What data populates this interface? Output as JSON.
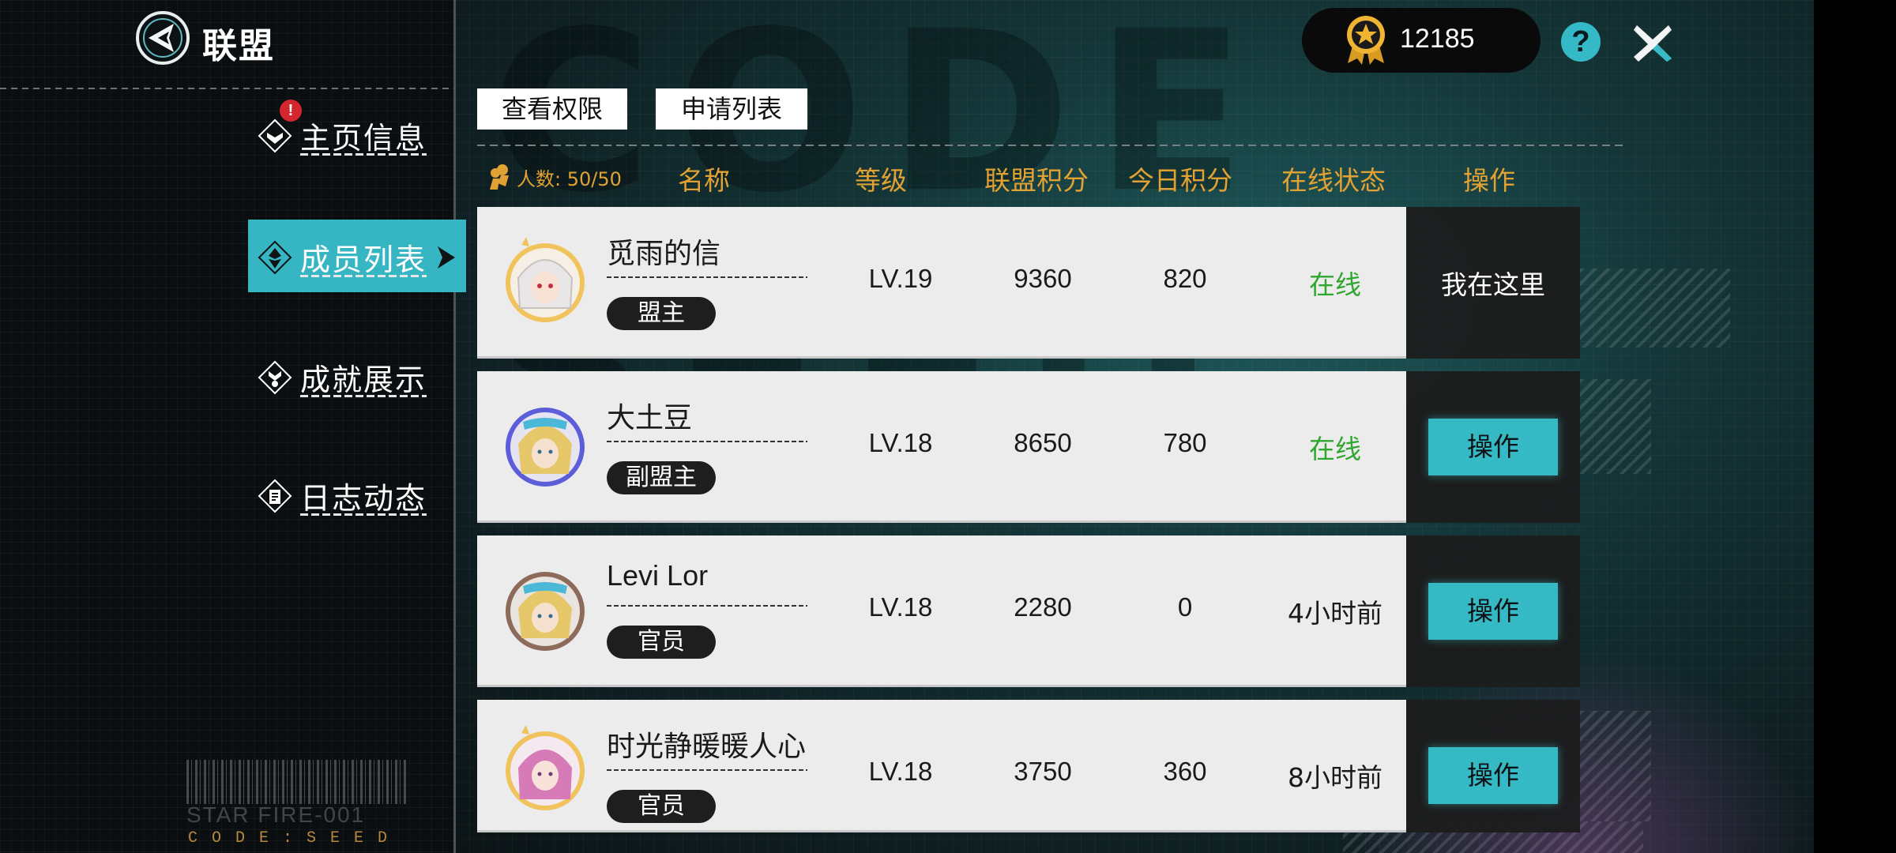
{
  "header": {
    "title": "联盟",
    "currency_value": "12185"
  },
  "sidebar": {
    "items": [
      {
        "label": "主页信息",
        "active": false,
        "alert": "!"
      },
      {
        "label": "成员列表",
        "active": true
      },
      {
        "label": "成就展示",
        "active": false
      },
      {
        "label": "日志动态",
        "active": false
      }
    ],
    "brand_line1": "STAR FIRE-001",
    "brand_line2": "CODE:SEED"
  },
  "tabs": [
    "查看权限",
    "申请列表"
  ],
  "table": {
    "member_count_label": "人数: 50/50",
    "columns": [
      "名称",
      "等级",
      "联盟积分",
      "今日积分",
      "在线状态",
      "操作"
    ],
    "rows": [
      {
        "name": "觅雨的信",
        "role": "盟主",
        "level": "LV.19",
        "alliance_points": "9360",
        "today_points": "820",
        "status": "在线",
        "action": "我在这里"
      },
      {
        "name": "大土豆",
        "role": "副盟主",
        "level": "LV.18",
        "alliance_points": "8650",
        "today_points": "780",
        "status": "在线",
        "action": "操作"
      },
      {
        "name": "Levi Lor",
        "role": "官员",
        "level": "LV.18",
        "alliance_points": "2280",
        "today_points": "0",
        "status": "4小时前",
        "action": "操作"
      },
      {
        "name": "时光静暖暖人心",
        "role": "官员",
        "level": "LV.18",
        "alliance_points": "3750",
        "today_points": "360",
        "status": "8小时前",
        "action": "操作"
      }
    ]
  },
  "colors": {
    "accent": "#36b6c3",
    "header_text": "#e2a233",
    "online": "#2fa72f"
  }
}
